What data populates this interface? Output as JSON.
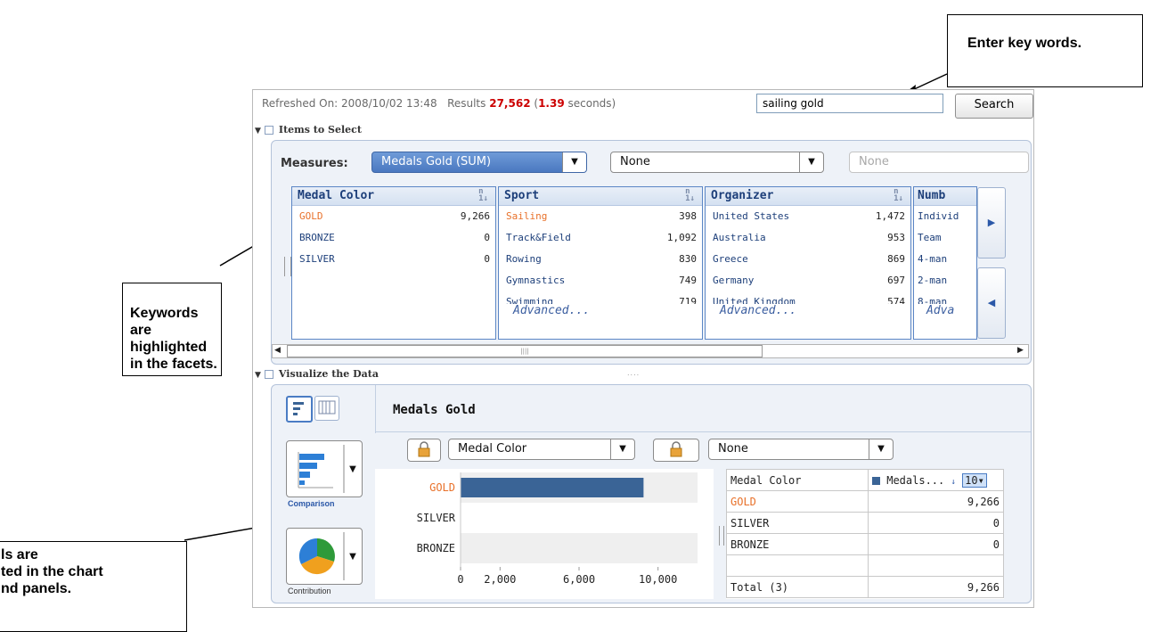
{
  "callouts": {
    "keywords_enter": "Enter key words.",
    "facets_highlight": "Keywords are highlighted in the facets.",
    "chart_highlight": "ls are\nted in the chart\nnd panels."
  },
  "header": {
    "refreshed_label": "Refreshed On: 2008/10/02 13:48",
    "results_label": "Results",
    "results_count": "27,562",
    "results_time": "1.39",
    "results_open": "(",
    "results_suffix": "seconds)",
    "search_value": "sailing gold",
    "search_button": "Search"
  },
  "items_section": {
    "title": "Items to Select",
    "measures_label": "Measures:",
    "measure1": "Medals Gold (SUM)",
    "measure2": "None",
    "measure3": "None"
  },
  "facets": [
    {
      "title": "Medal Color",
      "rows": [
        {
          "name": "GOLD",
          "value": "9,266",
          "highlight": true
        },
        {
          "name": "BRONZE",
          "value": "0"
        },
        {
          "name": "SILVER",
          "value": "0"
        }
      ],
      "advanced": ""
    },
    {
      "title": "Sport",
      "rows": [
        {
          "name": "Sailing",
          "value": "398",
          "highlight": true
        },
        {
          "name": "Track&Field",
          "value": "1,092"
        },
        {
          "name": "Rowing",
          "value": "830"
        },
        {
          "name": "Gymnastics",
          "value": "749"
        },
        {
          "name": "Swimming",
          "value": "719"
        }
      ],
      "advanced": "Advanced..."
    },
    {
      "title": "Organizer",
      "rows": [
        {
          "name": "United States",
          "value": "1,472"
        },
        {
          "name": "Australia",
          "value": "953"
        },
        {
          "name": "Greece",
          "value": "869"
        },
        {
          "name": "Germany",
          "value": "697"
        },
        {
          "name": "United Kingdom",
          "value": "574"
        }
      ],
      "advanced": "Advanced..."
    },
    {
      "title": "Numb",
      "rows": [
        {
          "name": "Individ",
          "value": ""
        },
        {
          "name": "Team",
          "value": ""
        },
        {
          "name": "4-man",
          "value": ""
        },
        {
          "name": "2-man",
          "value": ""
        },
        {
          "name": "8-man",
          "value": ""
        }
      ],
      "advanced": "Adva"
    }
  ],
  "visualize_section": {
    "title": "Visualize the Data",
    "chart_title": "Medals Gold",
    "dim1": "Medal Color",
    "dim2": "None",
    "comparison_label": "Comparison",
    "contribution_label": "Contribution"
  },
  "chart_data": {
    "type": "bar",
    "orientation": "horizontal",
    "categories": [
      "GOLD",
      "SILVER",
      "BRONZE"
    ],
    "values": [
      9266,
      0,
      0
    ],
    "xticks": [
      "0",
      "2,000",
      "6,000",
      "10,000"
    ],
    "xlim": [
      0,
      12000
    ],
    "highlight_category": "GOLD",
    "bar_color": "#3a6496",
    "highlight_color": "#e8712a"
  },
  "table": {
    "col1": "Medal Color",
    "col2": "Medals...",
    "top_n": "10",
    "rows": [
      {
        "name": "GOLD",
        "value": "9,266",
        "highlight": true
      },
      {
        "name": "SILVER",
        "value": "0"
      },
      {
        "name": "BRONZE",
        "value": "0"
      }
    ],
    "total_label": "Total (3)",
    "total_value": "9,266"
  },
  "colors": {
    "highlight": "#e8712a",
    "accent": "#2b58a8",
    "results_red": "#cc0000"
  }
}
